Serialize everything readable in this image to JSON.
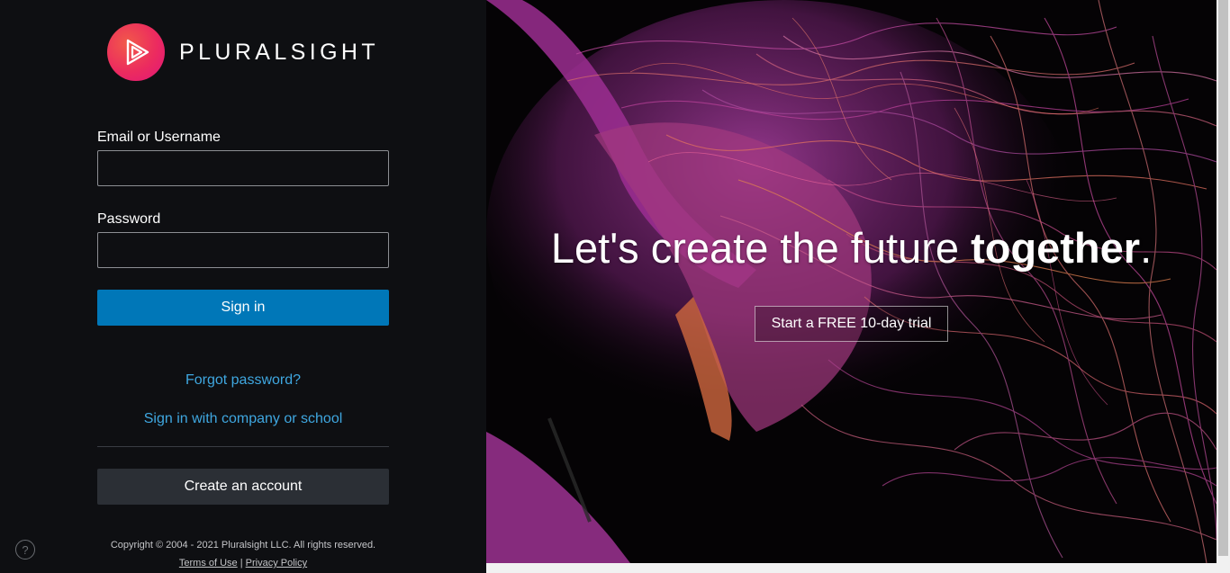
{
  "brand": {
    "name": "PLURALSIGHT"
  },
  "form": {
    "email_label": "Email or Username",
    "email_value": "",
    "password_label": "Password",
    "password_value": "",
    "signin_label": "Sign in",
    "forgot_label": "Forgot password?",
    "company_label": "Sign in with company or school",
    "create_label": "Create an account"
  },
  "footer": {
    "copyright": "Copyright © 2004 - 2021 Pluralsight LLC. All rights reserved.",
    "terms": "Terms of Use",
    "separator": "|",
    "privacy": "Privacy Policy",
    "help_glyph": "?"
  },
  "hero": {
    "headline_regular": "Let's create the future ",
    "headline_bold": "together",
    "headline_end": ".",
    "trial_label": "Start a FREE 10-day trial"
  },
  "colors": {
    "primary_button": "#0077b8",
    "link": "#3fa7e0",
    "brand_gradient_start": "#f15a49",
    "brand_gradient_end": "#e0157a"
  }
}
